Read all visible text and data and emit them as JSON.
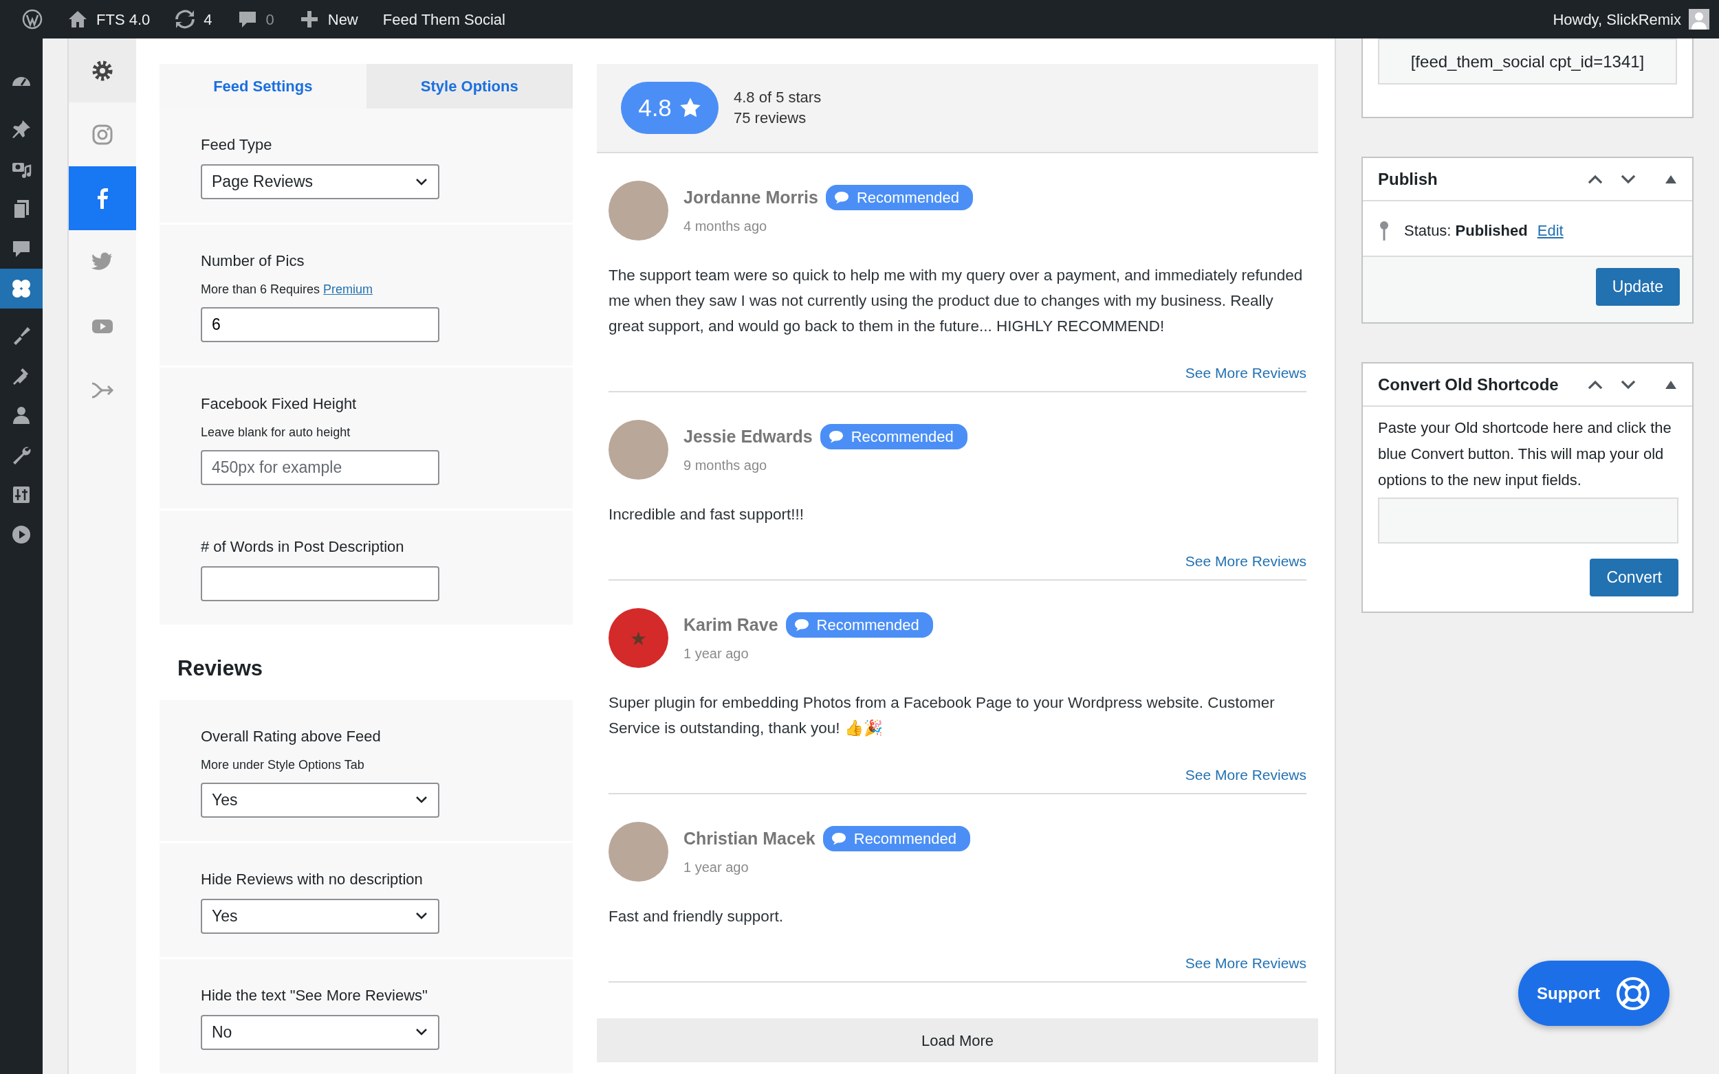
{
  "topbar": {
    "items": [
      {
        "kind": "logo"
      },
      {
        "kind": "home",
        "label": "FTS 4.0"
      },
      {
        "kind": "updates",
        "label": "4"
      },
      {
        "kind": "comments",
        "label": "0"
      },
      {
        "kind": "new",
        "label": "New"
      },
      {
        "kind": "text",
        "label": "Feed Them Social"
      }
    ],
    "greeting": "Howdy, SlickRemix"
  },
  "admin_menu": [
    {
      "kind": "dashboard",
      "selected": false
    },
    {
      "kind": "posts",
      "selected": false
    },
    {
      "kind": "media",
      "selected": false
    },
    {
      "kind": "pages",
      "selected": false
    },
    {
      "kind": "comments",
      "selected": false
    },
    {
      "kind": "feeds",
      "selected": true
    },
    {
      "kind": "appearance",
      "selected": false
    },
    {
      "kind": "plugins",
      "selected": false
    },
    {
      "kind": "users",
      "selected": false
    },
    {
      "kind": "tools",
      "selected": false
    },
    {
      "kind": "settings",
      "selected": false
    },
    {
      "kind": "video",
      "selected": false
    }
  ],
  "feed_types": [
    {
      "kind": "settings",
      "selected": false
    },
    {
      "kind": "instagram",
      "selected": false
    },
    {
      "kind": "facebook",
      "selected": true
    },
    {
      "kind": "twitter",
      "selected": false
    },
    {
      "kind": "youtube",
      "selected": false
    },
    {
      "kind": "combined",
      "selected": false
    }
  ],
  "tabs": [
    {
      "label": "Feed Settings",
      "selected": true
    },
    {
      "label": "Style Options",
      "selected": false
    }
  ],
  "settings": [
    {
      "kind": "select",
      "label": "Feed Type",
      "value": "Page Reviews"
    },
    {
      "kind": "input",
      "label": "Number of Pics",
      "note": "More than 6 Requires",
      "note_link": "Premium",
      "value": "6"
    },
    {
      "kind": "input",
      "label": "Facebook Fixed Height",
      "note": "Leave blank for auto height",
      "placeholder": "450px for example"
    },
    {
      "kind": "input",
      "label": "# of Words in Post Description"
    }
  ],
  "reviews_heading": "Reviews",
  "review_settings": [
    {
      "kind": "select",
      "label": "Overall Rating above Feed",
      "note": "More under Style Options Tab",
      "value": "Yes"
    },
    {
      "kind": "select",
      "label": "Hide Reviews with no description",
      "value": "Yes"
    },
    {
      "kind": "select",
      "label": "Hide the text \"See More Reviews\"",
      "value": "No"
    }
  ],
  "rating": {
    "score": "4.8",
    "summary": "4.8 of 5 stars",
    "count": "75 reviews"
  },
  "reviews": [
    {
      "kind": "photo",
      "name": "Jordanne Morris",
      "badge": "Recommended",
      "time": "4 months ago",
      "text": "The support team were so quick to help me with my query over a payment, and immediately refunded me when they saw I was not currently using the product due to changes with my business. Really great support, and would go back to them in the future... HIGHLY RECOMMEND!",
      "link": "See More Reviews"
    },
    {
      "kind": "photo",
      "name": "Jessie Edwards",
      "badge": "Recommended",
      "time": "9 months ago",
      "text": "Incredible and fast support!!!",
      "link": "See More Reviews"
    },
    {
      "kind": "emblem",
      "name": "Karim Rave",
      "badge": "Recommended",
      "time": "1 year ago",
      "text": "Super plugin for embedding Photos from a Facebook Page to your Wordpress website. Customer Service is outstanding, thank you! 👍🎉",
      "link": "See More Reviews"
    },
    {
      "kind": "photo",
      "name": "Christian Macek",
      "badge": "Recommended",
      "time": "1 year ago",
      "text": "Fast and friendly support.",
      "link": "See More Reviews"
    }
  ],
  "load_more": "Load More",
  "shortcode": "[feed_them_social cpt_id=1341]",
  "publish": {
    "title": "Publish",
    "status_label": "Status:",
    "status": "Published",
    "edit": "Edit",
    "button": "Update"
  },
  "convert": {
    "title": "Convert Old Shortcode",
    "text": "Paste your Old shortcode here and click the blue Convert button. This will map your old options to the new input fields.",
    "button": "Convert"
  },
  "support": "Support"
}
